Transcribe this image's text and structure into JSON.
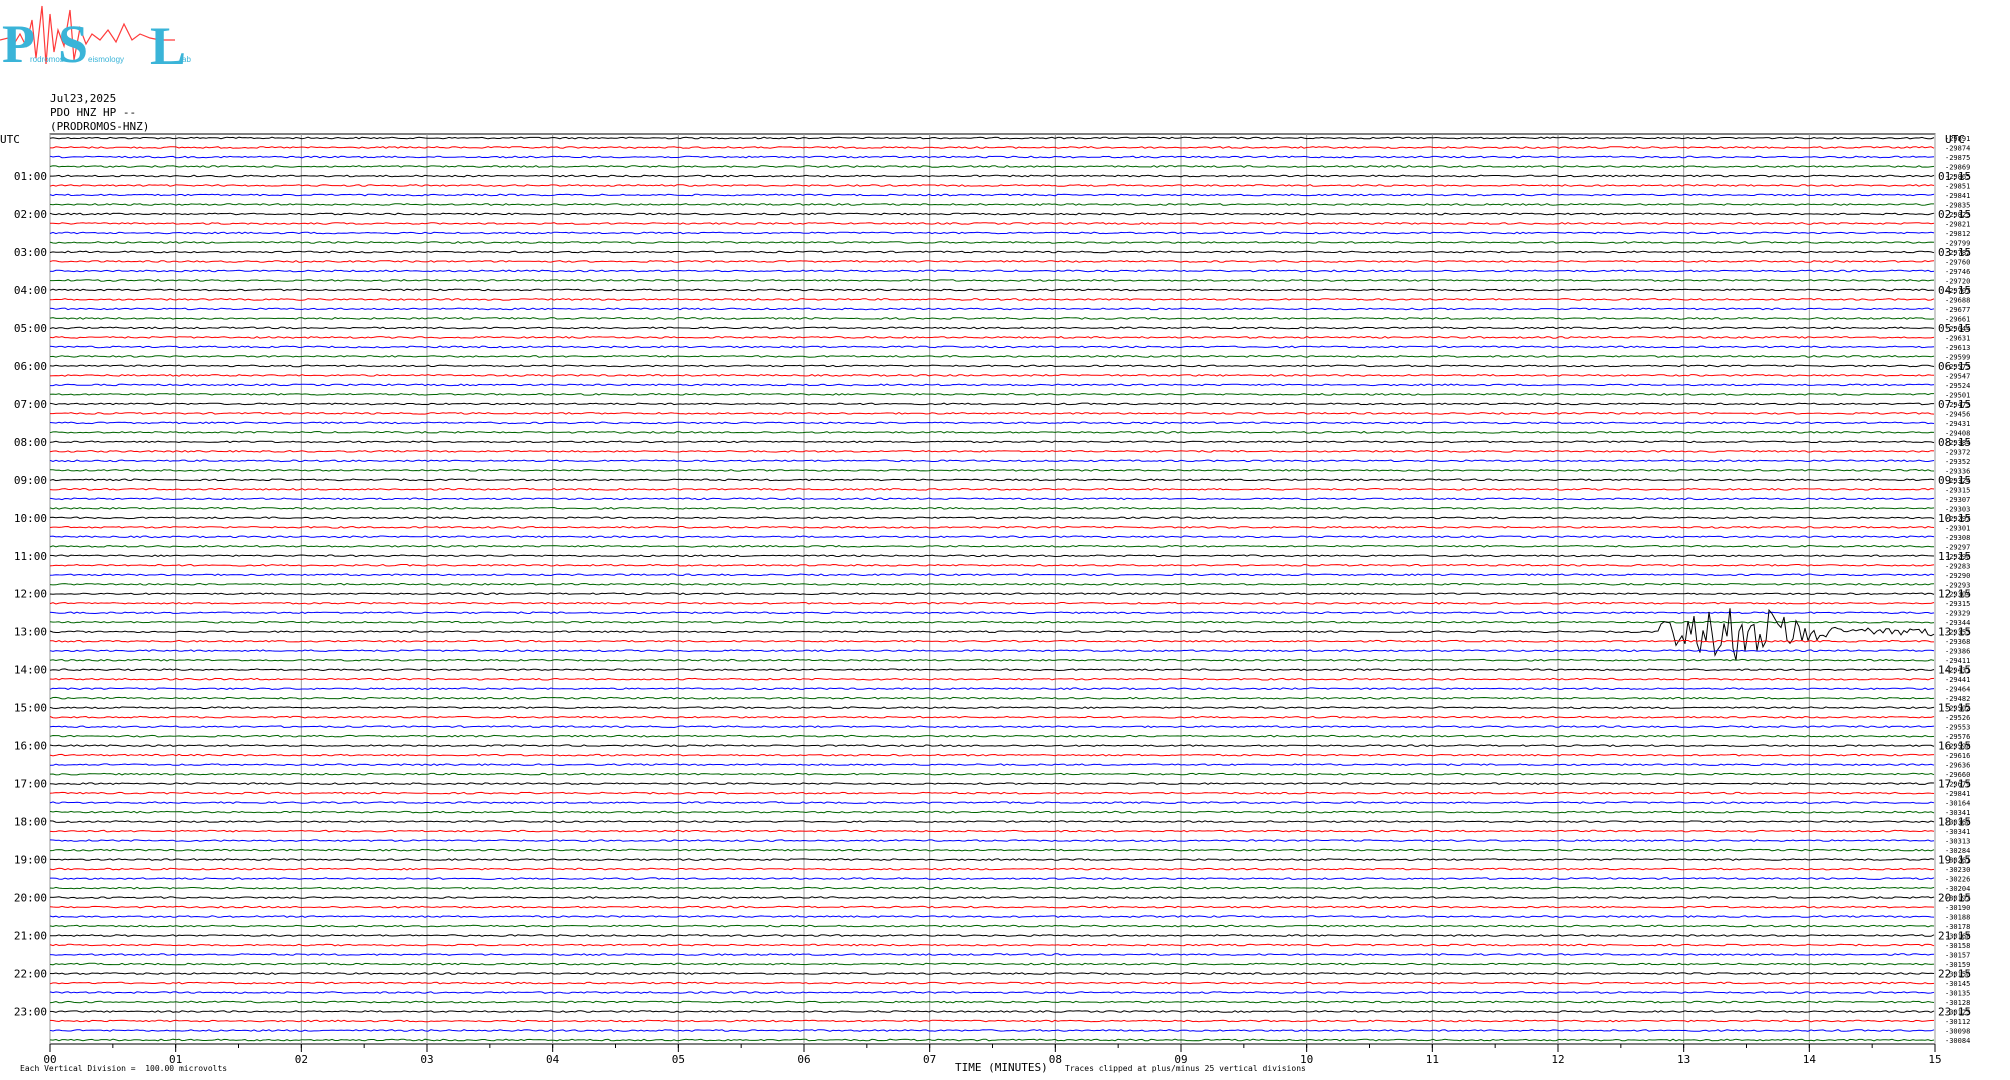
{
  "logo": {
    "letters": [
      "P",
      "S",
      "L"
    ],
    "words": [
      "rodromos",
      "eismology",
      "ab"
    ],
    "primary_color": "#3ab4d8",
    "waveform_color": "#ff3b3b"
  },
  "header": {
    "date": "Jul23,2025",
    "channel": "PDO HNZ HP --",
    "station": "(PRODROMOS-HNZ)"
  },
  "footer": {
    "left_note": "Each Vertical Division =  100.00 microvolts",
    "axis_title": "TIME (MINUTES)",
    "clip_note": "Traces clipped at plus/minus 25 vertical divisions"
  },
  "chart_data": {
    "type": "line",
    "title": "",
    "xlabel": "TIME (MINUTES)",
    "ylabel": "",
    "xlim": [
      0,
      15
    ],
    "x_ticks": [
      "00",
      "01",
      "02",
      "03",
      "04",
      "05",
      "06",
      "07",
      "08",
      "09",
      "10",
      "11",
      "12",
      "13",
      "14",
      "15"
    ],
    "left_axis_label": "UTC",
    "right_axis_label": "UTC",
    "left_hour_labels": [
      "01:00",
      "02:00",
      "03:00",
      "04:00",
      "05:00",
      "06:00",
      "07:00",
      "08:00",
      "09:00",
      "10:00",
      "11:00",
      "12:00",
      "13:00",
      "14:00",
      "15:00",
      "16:00",
      "17:00",
      "18:00",
      "19:00",
      "20:00",
      "21:00",
      "22:00",
      "23:00"
    ],
    "right_hour_labels": [
      "01:15",
      "02:15",
      "03:15",
      "04:15",
      "05:15",
      "06:15",
      "07:15",
      "08:15",
      "09:15",
      "10:15",
      "11:15",
      "12:15",
      "13:15",
      "14:15",
      "15:15",
      "16:15",
      "17:15",
      "18:15",
      "19:15",
      "20:15",
      "21:15",
      "22:15",
      "23:15"
    ],
    "trace_interval_minutes": 15,
    "trace_colors": [
      "#000000",
      "#ff0000",
      "#0000ff",
      "#006400"
    ],
    "grid": true,
    "traces": [
      {
        "offset": -29891
      },
      {
        "offset": -29874
      },
      {
        "offset": -29875
      },
      {
        "offset": -29869
      },
      {
        "offset": -29865
      },
      {
        "offset": -29851
      },
      {
        "offset": -29841
      },
      {
        "offset": -29835
      },
      {
        "offset": -29823
      },
      {
        "offset": -29821
      },
      {
        "offset": -29812
      },
      {
        "offset": -29799
      },
      {
        "offset": -29782
      },
      {
        "offset": -29760
      },
      {
        "offset": -29746
      },
      {
        "offset": -29720
      },
      {
        "offset": -29707
      },
      {
        "offset": -29688
      },
      {
        "offset": -29677
      },
      {
        "offset": -29661
      },
      {
        "offset": -29644
      },
      {
        "offset": -29631
      },
      {
        "offset": -29613
      },
      {
        "offset": -29599
      },
      {
        "offset": -29573
      },
      {
        "offset": -29547
      },
      {
        "offset": -29524
      },
      {
        "offset": -29501
      },
      {
        "offset": -29473
      },
      {
        "offset": -29456
      },
      {
        "offset": -29431
      },
      {
        "offset": -29408
      },
      {
        "offset": -29384
      },
      {
        "offset": -29372
      },
      {
        "offset": -29352
      },
      {
        "offset": -29336
      },
      {
        "offset": -29324
      },
      {
        "offset": -29315
      },
      {
        "offset": -29307
      },
      {
        "offset": -29303
      },
      {
        "offset": -29297
      },
      {
        "offset": -29301
      },
      {
        "offset": -29308
      },
      {
        "offset": -29297
      },
      {
        "offset": -29290
      },
      {
        "offset": -29283
      },
      {
        "offset": -29290
      },
      {
        "offset": -29293
      },
      {
        "offset": -29304
      },
      {
        "offset": -29315
      },
      {
        "offset": -29329
      },
      {
        "offset": -29344
      },
      {
        "offset": -29353,
        "event": {
          "start_min": 12.8,
          "peak_min": 13.55,
          "end_min": 15.0,
          "amplitude_div": 6.5
        }
      },
      {
        "offset": -29368
      },
      {
        "offset": -29386
      },
      {
        "offset": -29411
      },
      {
        "offset": -29431
      },
      {
        "offset": -29441
      },
      {
        "offset": -29464
      },
      {
        "offset": -29482
      },
      {
        "offset": -29502
      },
      {
        "offset": -29526
      },
      {
        "offset": -29553
      },
      {
        "offset": -29576
      },
      {
        "offset": -29598
      },
      {
        "offset": -29616
      },
      {
        "offset": -29636
      },
      {
        "offset": -29660
      },
      {
        "offset": -29679
      },
      {
        "offset": -29841
      },
      {
        "offset": -30164
      },
      {
        "offset": -30341
      },
      {
        "offset": -30360
      },
      {
        "offset": -30341
      },
      {
        "offset": -30313
      },
      {
        "offset": -30284
      },
      {
        "offset": -30261
      },
      {
        "offset": -30230
      },
      {
        "offset": -30226
      },
      {
        "offset": -30204
      },
      {
        "offset": -30197
      },
      {
        "offset": -30190
      },
      {
        "offset": -30188
      },
      {
        "offset": -30178
      },
      {
        "offset": -30168
      },
      {
        "offset": -30158
      },
      {
        "offset": -30157
      },
      {
        "offset": -30159
      },
      {
        "offset": -30150
      },
      {
        "offset": -30145
      },
      {
        "offset": -30135
      },
      {
        "offset": -30128
      },
      {
        "offset": -30123
      },
      {
        "offset": -30112
      },
      {
        "offset": -30098
      },
      {
        "offset": -30084
      }
    ]
  }
}
